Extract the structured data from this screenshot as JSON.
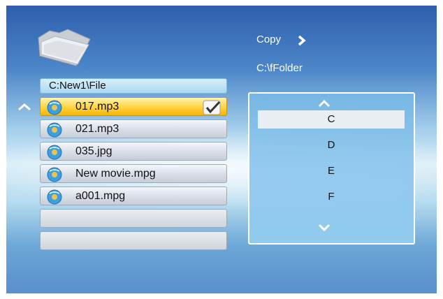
{
  "file_browser": {
    "current_path": "C:New1\\File",
    "files": [
      {
        "name": "017.mp3",
        "selected": true,
        "checked": true
      },
      {
        "name": "021.mp3",
        "selected": false,
        "checked": false
      },
      {
        "name": "035.jpg",
        "selected": false,
        "checked": false
      },
      {
        "name": "New movie.mpg",
        "selected": false,
        "checked": false
      },
      {
        "name": "a001.mpg",
        "selected": false,
        "checked": false
      }
    ],
    "empty_rows": 2,
    "icons": {
      "folder": "folder-icon",
      "file": "media-file-icon",
      "scroll_up": "chevron-up-icon",
      "check": "checkmark-icon"
    }
  },
  "operation": {
    "action_label": "Copy",
    "action_icon": "chevron-right-icon",
    "destination_path": "C:\\fFolder"
  },
  "drive_picker": {
    "drives": [
      "C",
      "D",
      "E",
      "F"
    ],
    "selected_index": 0,
    "icons": {
      "scroll_up": "chevron-up-icon",
      "scroll_down": "chevron-down-icon"
    }
  },
  "colors": {
    "selection_highlight": "#ffd64a",
    "background_blue": "#4c86c8",
    "panel_border": "#ffffff"
  }
}
